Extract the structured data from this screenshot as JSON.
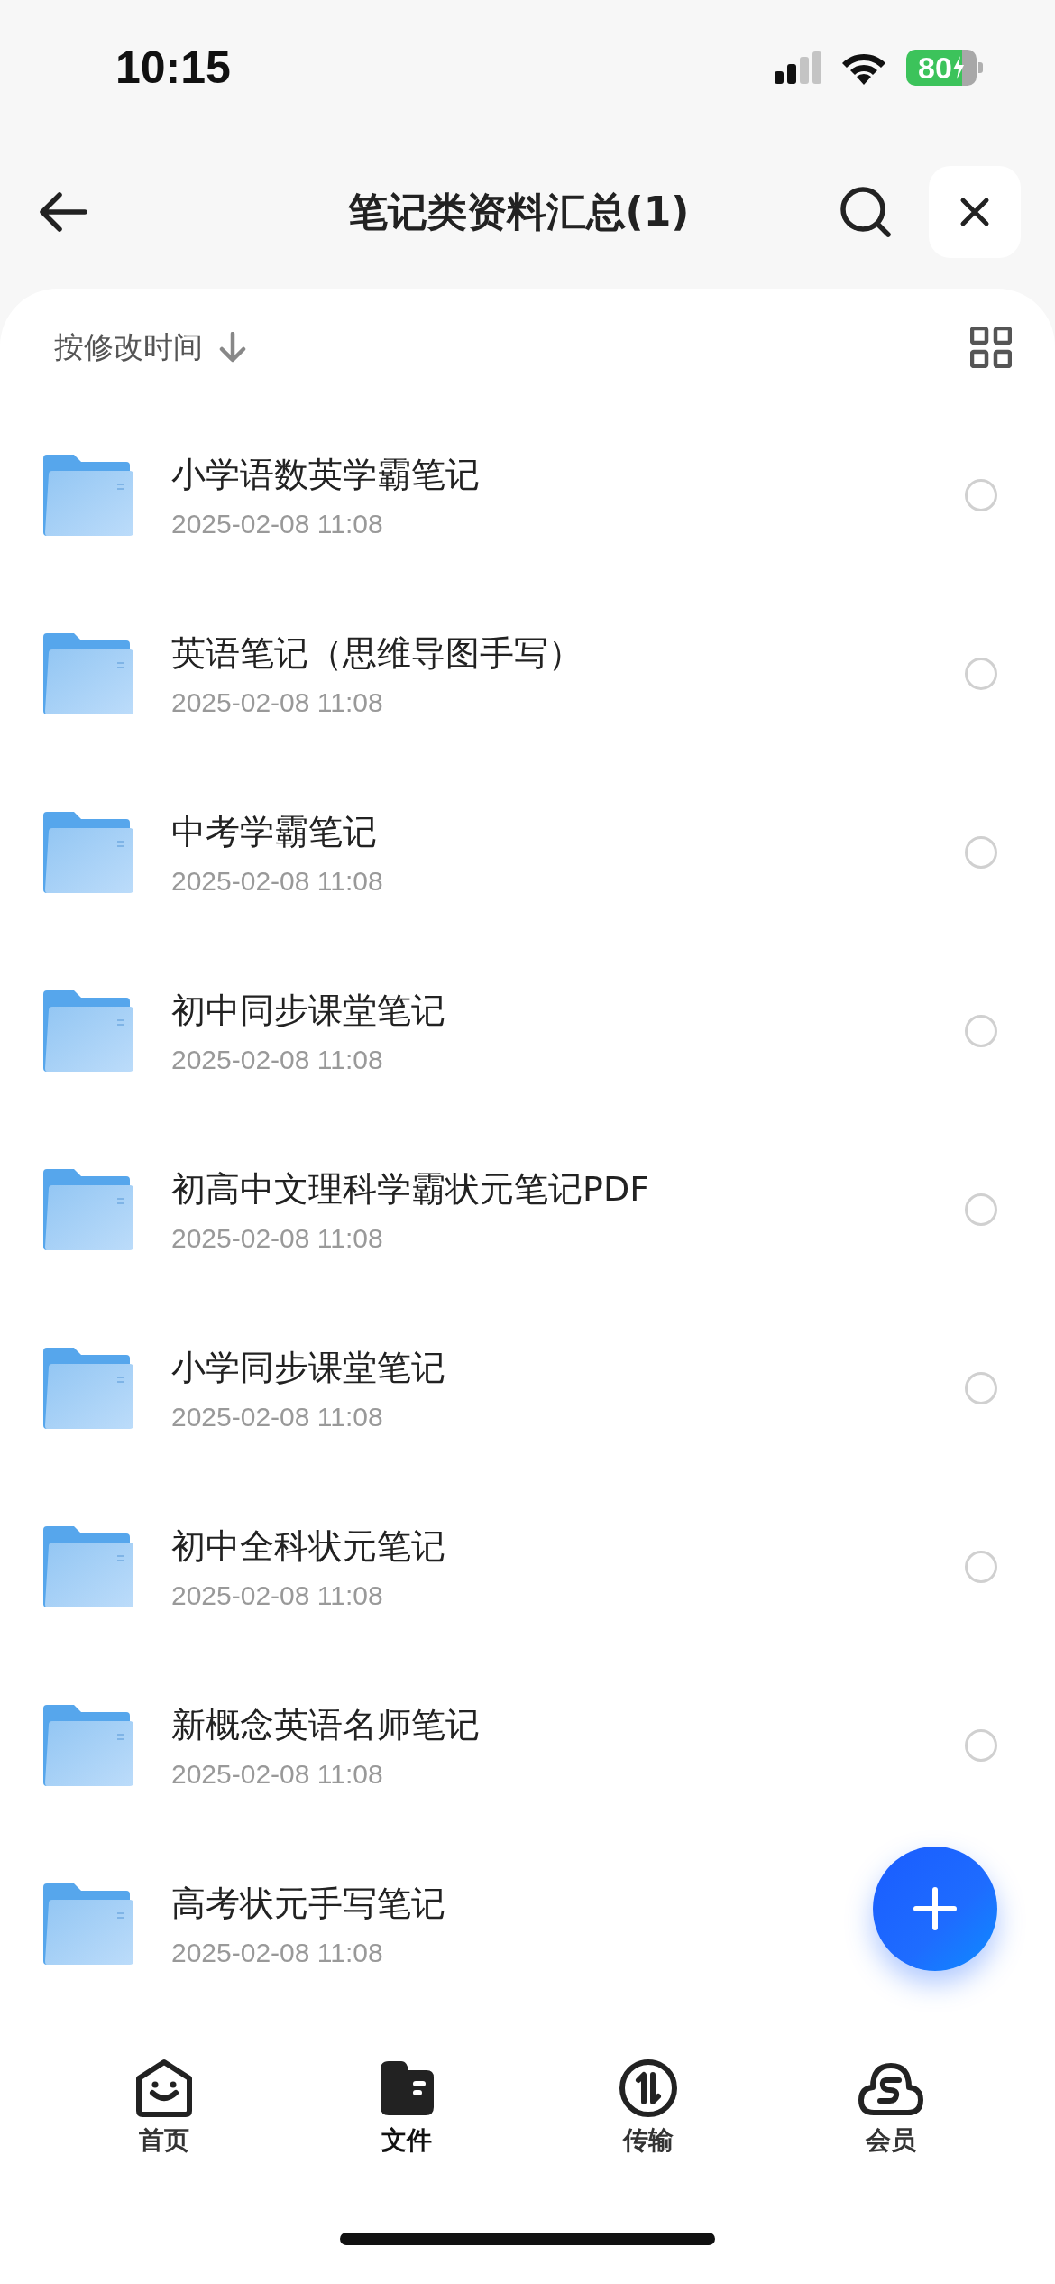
{
  "status_bar": {
    "time": "10:15",
    "battery": "80"
  },
  "header": {
    "title": "笔记类资料汇总(1)"
  },
  "sort": {
    "label": "按修改时间"
  },
  "items": [
    {
      "name": "小学语数英学霸笔记",
      "date": "2025-02-08 11:08",
      "selected": false
    },
    {
      "name": "英语笔记（思维导图手写）",
      "date": "2025-02-08 11:08",
      "selected": false
    },
    {
      "name": "中考学霸笔记",
      "date": "2025-02-08 11:08",
      "selected": false
    },
    {
      "name": "初中同步课堂笔记",
      "date": "2025-02-08 11:08",
      "selected": false
    },
    {
      "name": "初高中文理科学霸状元笔记PDF",
      "date": "2025-02-08 11:08",
      "selected": false
    },
    {
      "name": "小学同步课堂笔记",
      "date": "2025-02-08 11:08",
      "selected": false
    },
    {
      "name": "初中全科状元笔记",
      "date": "2025-02-08 11:08",
      "selected": false
    },
    {
      "name": "新概念英语名师笔记",
      "date": "2025-02-08 11:08",
      "selected": false
    },
    {
      "name": "高考状元手写笔记",
      "date": "2025-02-08 11:08"
    }
  ],
  "nav": [
    {
      "kind": "home",
      "label": "首页",
      "selected": false
    },
    {
      "kind": "files",
      "label": "文件",
      "selected": true
    },
    {
      "kind": "transfer",
      "label": "传输",
      "selected": false
    },
    {
      "kind": "vip",
      "label": "会员",
      "selected": false
    }
  ]
}
